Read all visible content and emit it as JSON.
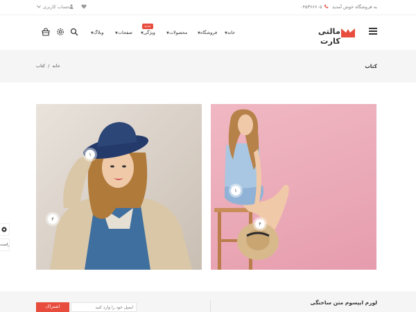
{
  "topbar": {
    "welcome": "به فروشگاه خوش آمدید",
    "phone": "۰۴۵۳۶۶۶۰۵",
    "account": "حساب کاربری"
  },
  "header": {
    "logo_text": "مالتی کارت",
    "nav": {
      "home": "خانه",
      "shop": "فروشگاه",
      "products": "محصولات",
      "features": "ویژگی",
      "features_badge": "جدید",
      "pages": "صفحات",
      "blog": "وبلاگ"
    }
  },
  "breadcrumb": {
    "title": "کتاب",
    "home": "خانه",
    "separator": "/",
    "current": "کتاب"
  },
  "lookbook": {
    "left_hotspots": [
      "۱",
      "۲"
    ],
    "right_hotspots": [
      "۱",
      "۲"
    ]
  },
  "side": {
    "rtl_label": "راست"
  },
  "footer": {
    "title": "لورم ایپسوم متن ساختگی",
    "email_placeholder": "ایمیل خود را وارد کنید",
    "subscribe": "اشتراک"
  },
  "colors": {
    "accent": "#e74c3c",
    "band": "#f5f5f5"
  }
}
